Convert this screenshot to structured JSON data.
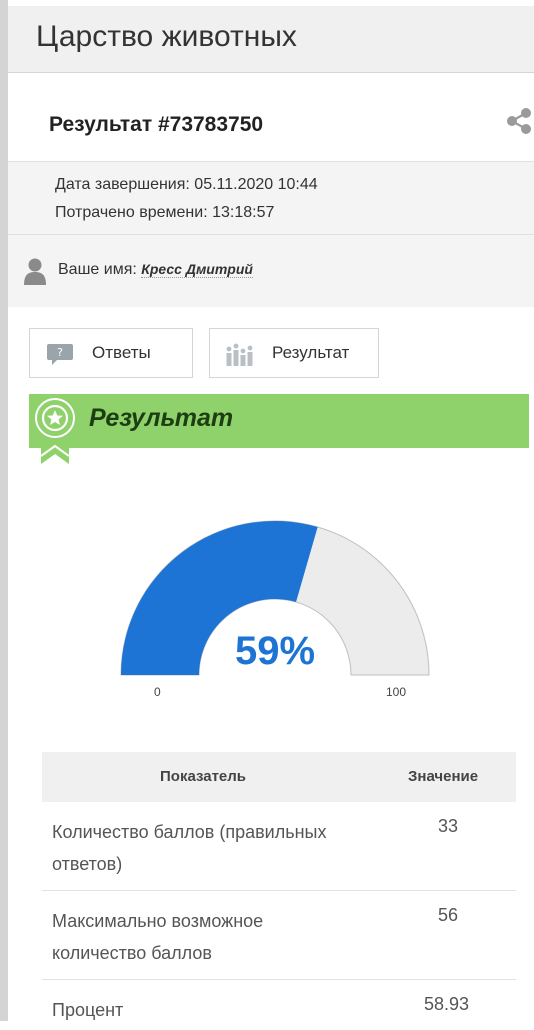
{
  "header": {
    "title": "Царство животных"
  },
  "result": {
    "title": "Результат #73783750"
  },
  "meta": {
    "completed": "Дата завершения: 05.11.2020 10:44",
    "time_spent": "Потрачено времени: 13:18:57"
  },
  "user": {
    "label": "Ваше имя: ",
    "name": "Кресс Дмитрий"
  },
  "buttons": {
    "answers": "Ответы",
    "result": "Результат"
  },
  "banner": {
    "title": "Результат"
  },
  "gauge": {
    "percent_label": "59%",
    "value": 58.93,
    "min": "0",
    "max": "100"
  },
  "table": {
    "headers": [
      "Показатель",
      "Значение"
    ],
    "rows": [
      {
        "label": "Количество баллов (правильных ответов)",
        "value": "33"
      },
      {
        "label": "Максимально возможное количество баллов",
        "value": "56"
      },
      {
        "label": "Процент",
        "value": "58.93"
      }
    ]
  },
  "colors": {
    "gauge_fill": "#1e74d4",
    "gauge_bg": "#ececec",
    "banner": "#8fd16a"
  },
  "icons": [
    "share-icon",
    "user-icon",
    "speech-bubble-icon",
    "bar-chart-icon",
    "award-badge-icon"
  ]
}
